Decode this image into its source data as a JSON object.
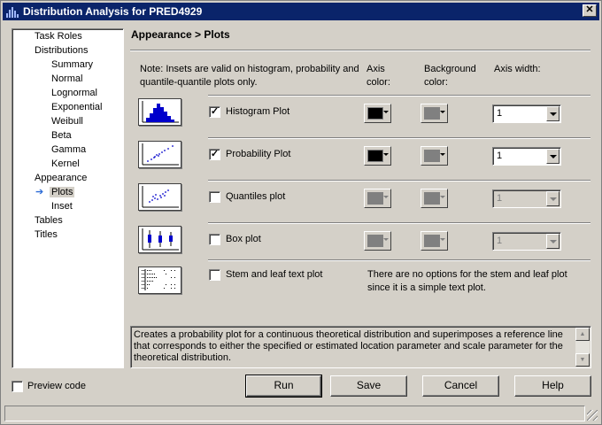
{
  "window": {
    "title": "Distribution Analysis for PRED4929",
    "close_glyph": "✕"
  },
  "sidebar": {
    "items": [
      {
        "label": "Task Roles"
      },
      {
        "label": "Distributions"
      },
      {
        "label": "Summary"
      },
      {
        "label": "Normal"
      },
      {
        "label": "Lognormal"
      },
      {
        "label": "Exponential"
      },
      {
        "label": "Weibull"
      },
      {
        "label": "Beta"
      },
      {
        "label": "Gamma"
      },
      {
        "label": "Kernel"
      },
      {
        "label": "Appearance"
      },
      {
        "label": "Plots",
        "selected": true
      },
      {
        "label": "Inset"
      },
      {
        "label": "Tables"
      },
      {
        "label": "Titles"
      }
    ]
  },
  "header": {
    "title": "Appearance > Plots"
  },
  "note": "Note: Insets are valid on histogram, probability and quantile-quantile plots only.",
  "columns": {
    "axis_color": "Axis color:",
    "background_color": "Background color:",
    "axis_width": "Axis width:"
  },
  "plots": [
    {
      "label": "Histogram Plot",
      "checked": true,
      "checkmark": "✓",
      "axis_color": "#000000",
      "background_color": "#808080",
      "axis_width": "1",
      "enabled": true
    },
    {
      "label": "Probability Plot",
      "checked": true,
      "checkmark": "✓",
      "axis_color": "#000000",
      "background_color": "#808080",
      "axis_width": "1",
      "enabled": true
    },
    {
      "label": "Quantiles plot",
      "checked": false,
      "checkmark": "",
      "axis_color": "#808080",
      "background_color": "#808080",
      "axis_width": "1",
      "enabled": false
    },
    {
      "label": "Box plot",
      "checked": false,
      "checkmark": "",
      "axis_color": "#808080",
      "background_color": "#808080",
      "axis_width": "1",
      "enabled": false
    },
    {
      "label": "Stem and leaf text plot",
      "checked": false,
      "checkmark": ""
    }
  ],
  "stem_note": "There are no options for the stem and leaf plot since it is a simple text plot.",
  "description": "Creates a probability plot for a continuous theoretical distribution and superimposes a reference line that corresponds to either the specified or estimated location parameter and scale parameter for the theoretical distribution.",
  "preview": {
    "label": "Preview code",
    "checked": false
  },
  "buttons": {
    "run": "Run",
    "save": "Save",
    "cancel": "Cancel",
    "help": "Help"
  },
  "colors": {
    "titlebar": "#0a246a",
    "face": "#d4d0c8",
    "histogram_bars": "#0000cc",
    "selection_arrow": "#2c6bd6"
  },
  "icons": {
    "selection_arrow": "➔",
    "scroll_up": "▲",
    "scroll_down": "▼"
  }
}
